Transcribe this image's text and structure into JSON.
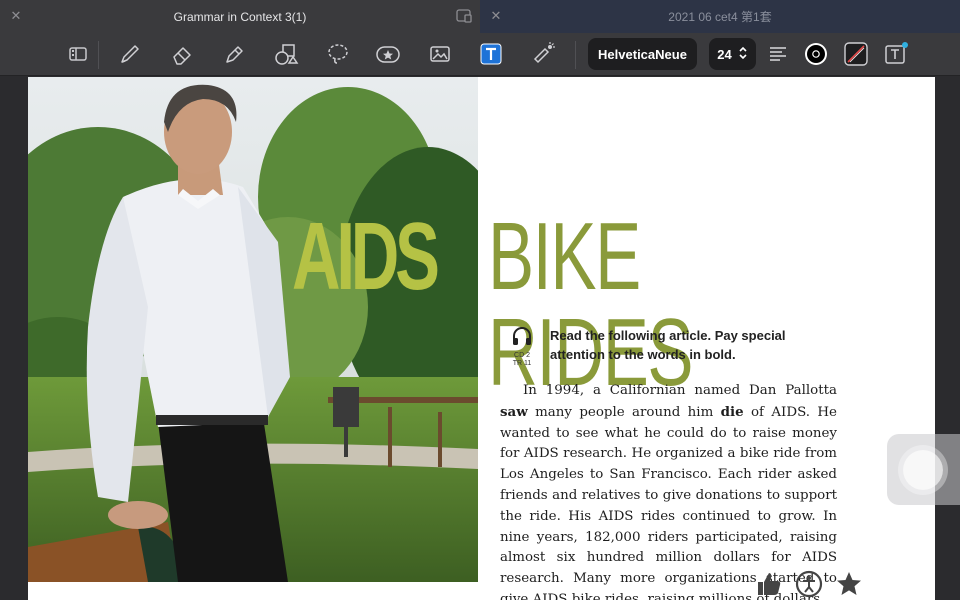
{
  "tabs": [
    {
      "title": "Grammar in Context 3(1)",
      "active": true
    },
    {
      "title": "2021 06 cet4 第1套",
      "active": false
    }
  ],
  "toolbar": {
    "tools": [
      "sidebar-icon",
      "pen-icon",
      "eraser-icon",
      "highlighter-icon",
      "shapes-icon",
      "lasso-icon",
      "sticker-icon",
      "image-icon",
      "text-icon",
      "laser-pointer-icon"
    ],
    "font_name": "HelveticaNeue",
    "font_size": "24",
    "text_color": "#000000",
    "accent": "#1e73d8"
  },
  "page": {
    "headline_part1": "AIDS",
    "headline_part2": "BIKE RIDES",
    "audio_label_1": "CD 2",
    "audio_label_2": "TR 11",
    "instruction_line1": "Read the following article. Pay special",
    "instruction_line2": "attention to the words in bold.",
    "article_seg1": "In 1994, a Californian named Dan Pallotta ",
    "article_bold1": "saw",
    "article_seg2": " many people around him ",
    "article_bold2": "die",
    "article_seg3": " of AIDS. He wanted to see what he could do to raise money for AIDS research. He organized a bike ride from Los Angeles to San Francisco. Each rider asked friends and relatives to give donations to support the ride. His AIDS rides continued to grow. In nine years, 182,000 riders participated, raising almost six hundred million dollars for AIDS research. Many more organizations started to give AIDS bike rides, raising millions of dollars."
  }
}
